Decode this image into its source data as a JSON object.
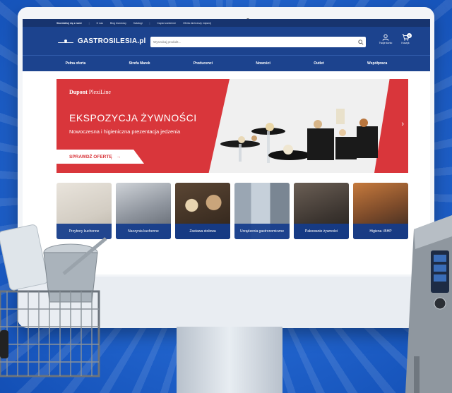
{
  "topbar": {
    "items": [
      "Skontaktuj się z nami",
      "O nas",
      "Blog branżowy",
      "Katalogi",
      "Części zamienne",
      "Oferta dla branży mięsnej"
    ]
  },
  "header": {
    "brand": "GASTROSILESIA.pl",
    "search_placeholder": "Wyszukaj produkt...",
    "account_label": "Twoje konto",
    "cart_label": "Koszyk",
    "cart_count": "0"
  },
  "nav": {
    "items": [
      "Pełna oferta",
      "Strefa Marek",
      "Producenci",
      "Nowości",
      "Outlet",
      "Współpraca"
    ]
  },
  "banner": {
    "brand_bold": "Dupont",
    "brand_light": "PlexiLine",
    "title": "EKSPOZYCJA ŻYWNOŚCI",
    "subtitle": "Nowoczesna i higieniczna prezentacja jedzenia",
    "cta": "SPRAWDŹ OFERTĘ",
    "accent_color": "#d9363b"
  },
  "categories": [
    {
      "label": "Przybory kuchenne"
    },
    {
      "label": "Naczynia kuchenne"
    },
    {
      "label": "Zastawa stołowa"
    },
    {
      "label": "Urządzenia gastronomiczne"
    },
    {
      "label": "Pakowanie żywności"
    },
    {
      "label": "Higiena i BHP"
    }
  ],
  "colors": {
    "navy": "#1c438e",
    "topbar": "#17346f",
    "background": "#1f5fc8"
  }
}
